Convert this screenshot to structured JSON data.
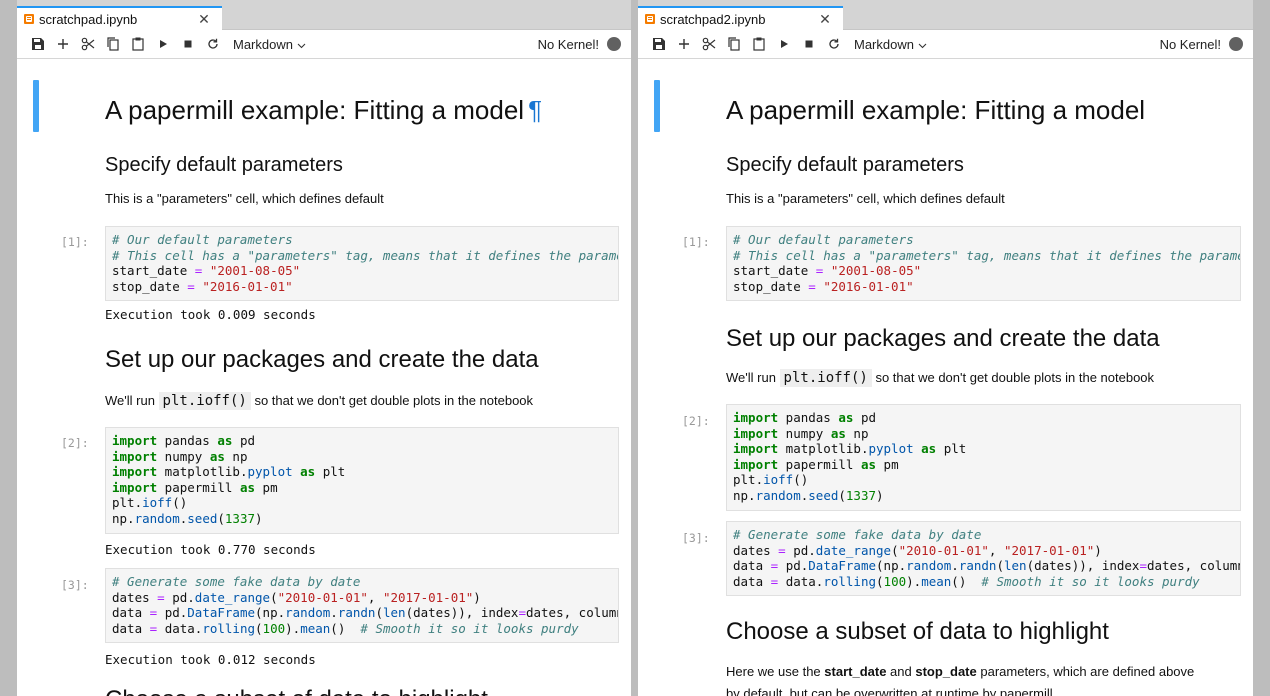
{
  "panes": {
    "left": {
      "tab_title": "scratchpad.ipynb",
      "tab_close": "✕",
      "celltype": "Markdown",
      "kernel": "No Kernel!",
      "h1": "A papermill example: Fitting a model",
      "pilcrow": "¶",
      "h2_params": "Specify default parameters",
      "params_text": "This is a \"parameters\" cell, which defines default",
      "prompt1": "[1]:",
      "exec1": "Execution took 0.009 seconds",
      "h2_setup": "Set up our packages and create the data",
      "setup_before": "We'll run ",
      "setup_code": "plt.ioff()",
      "setup_after": " so that we don't get double plots in the notebook",
      "prompt2": "[2]:",
      "exec2": "Execution took 0.770 seconds",
      "prompt3": "[3]:",
      "exec3": "Execution took 0.012 seconds",
      "h2_subset": "Choose a subset of data to highlight"
    },
    "right": {
      "tab_title": "scratchpad2.ipynb",
      "tab_close": "✕",
      "celltype": "Markdown",
      "kernel": "No Kernel!",
      "h1": "A papermill example: Fitting a model",
      "h2_params": "Specify default parameters",
      "params_text": "This is a \"parameters\" cell, which defines default",
      "prompt1": "[1]:",
      "h2_setup": "Set up our packages and create the data",
      "setup_before": "We'll run ",
      "setup_code": "plt.ioff()",
      "setup_after": " so that we don't get double plots in the notebook",
      "prompt2": "[2]:",
      "prompt3": "[3]:",
      "h2_subset": "Choose a subset of data to highlight",
      "subset_text_1a": "Here we use the ",
      "subset_bold1": "start_date",
      "subset_text_1b": " and ",
      "subset_bold2": "stop_date",
      "subset_text_1c": " parameters, which are defined above",
      "subset_text_2": "by default, but can be overwritten at runtime by papermill."
    }
  },
  "code": {
    "cell1": [
      "# Our default parameters",
      "# This cell has a \"parameters\" tag, means that it defines the paramet",
      "start_date = \"2001-08-05\"",
      "stop_date = \"2016-01-01\""
    ],
    "cell2": [
      "import pandas as pd",
      "import numpy as np",
      "import matplotlib.pyplot as plt",
      "import papermill as pm",
      "plt.ioff()",
      "np.random.seed(1337)"
    ],
    "cell3": [
      "# Generate some fake data by date",
      "dates = pd.date_range(\"2010-01-01\", \"2017-01-01\")",
      "data = pd.DataFrame(np.random.randn(len(dates)), index=dates, columns",
      "data = data.rolling(100).mean()  # Smooth it so it looks purdy"
    ]
  },
  "icons": [
    "save-icon",
    "add-icon",
    "cut-icon",
    "copy-icon",
    "paste-icon",
    "run-icon",
    "stop-icon",
    "restart-icon",
    "chevron-down-icon",
    "kernel-status-icon",
    "notebook-icon",
    "close-icon"
  ],
  "colors": {
    "accent": "#2196f3",
    "active_cell_bar": "#42a5f5",
    "notebook_icon": "#f57c00",
    "kernel_dot": "#616161"
  }
}
